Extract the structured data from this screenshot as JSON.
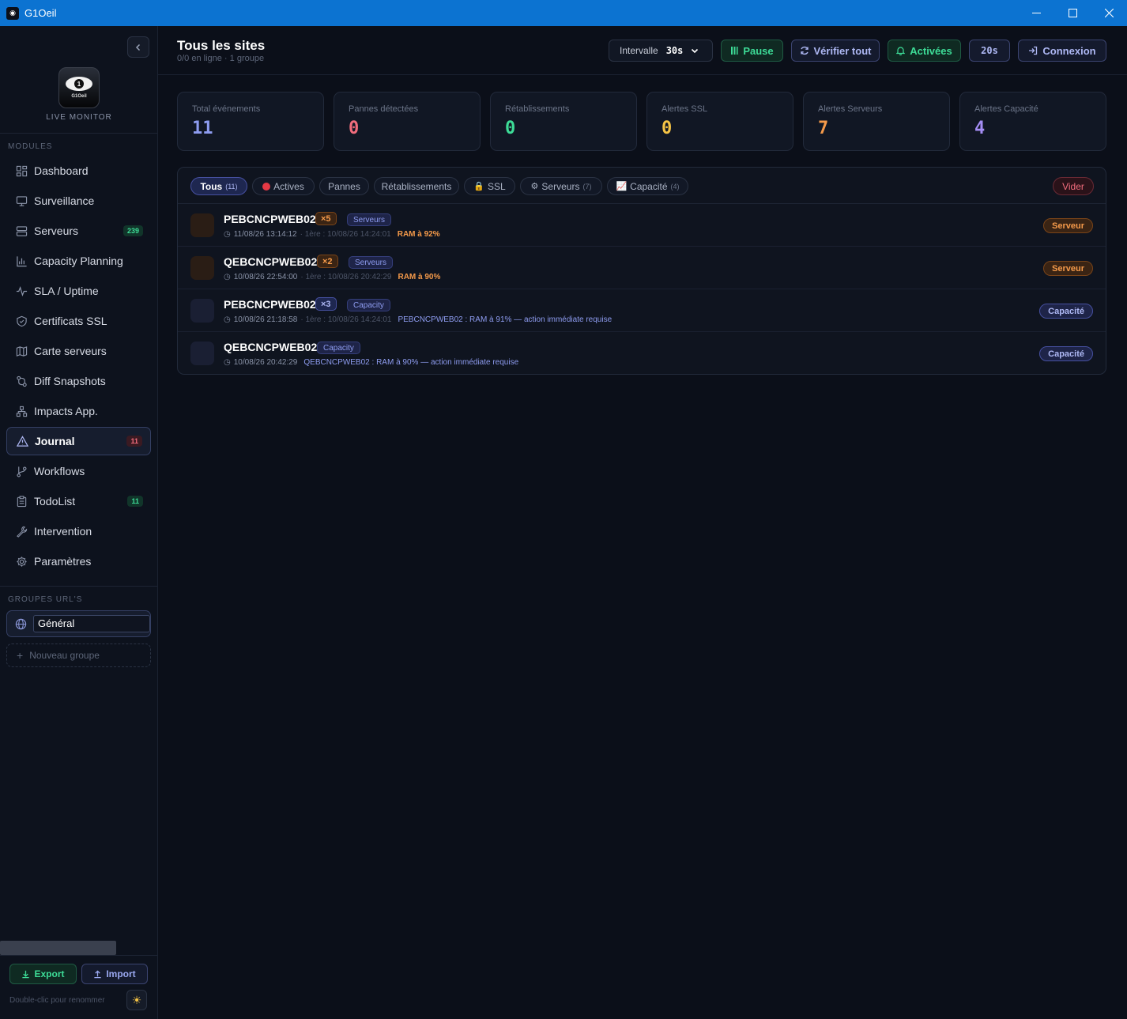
{
  "window": {
    "title": "G1Oeil",
    "minimize": "—",
    "maximize": "☐",
    "close": "✕"
  },
  "sidebar": {
    "logo_text": "G1Oeil",
    "logo_pupil": "1",
    "tagline": "LIVE MONITOR",
    "modules_label": "MODULES",
    "items": [
      {
        "label": "Dashboard",
        "icon": "dashboard-icon"
      },
      {
        "label": "Surveillance",
        "icon": "monitor-icon"
      },
      {
        "label": "Serveurs",
        "icon": "server-icon",
        "badge": "239"
      },
      {
        "label": "Capacity Planning",
        "icon": "bar-chart-icon"
      },
      {
        "label": "SLA / Uptime",
        "icon": "activity-icon"
      },
      {
        "label": "Certificats SSL",
        "icon": "shield-icon"
      },
      {
        "label": "Carte serveurs",
        "icon": "map-icon"
      },
      {
        "label": "Diff Snapshots",
        "icon": "diff-icon"
      },
      {
        "label": "Impacts App.",
        "icon": "network-icon"
      },
      {
        "label": "Journal",
        "icon": "alert-triangle-icon",
        "badge": "11",
        "active": true
      },
      {
        "label": "Workflows",
        "icon": "git-branch-icon"
      },
      {
        "label": "TodoList",
        "icon": "clipboard-icon",
        "badge": "11"
      },
      {
        "label": "Intervention",
        "icon": "wrench-icon"
      },
      {
        "label": "Paramètres",
        "icon": "gear-icon"
      }
    ],
    "groups_label": "GROUPES URL'S",
    "group_value": "Général",
    "new_group": "Nouveau groupe",
    "export_label": "Export",
    "import_label": "Import",
    "rename_hint": "Double-clic pour renommer"
  },
  "header": {
    "title": "Tous les sites",
    "subtitle": "0/0 en ligne · 1 groupe",
    "interval_label": "Intervalle",
    "interval_value": "30s",
    "pause_label": "Pause",
    "verify_label": "Vérifier tout",
    "alerts_label": "Activées",
    "timer": "20s",
    "connexion_label": "Connexion"
  },
  "stats": [
    {
      "label": "Total événements",
      "value": "11",
      "color": "#8e9cf0"
    },
    {
      "label": "Pannes détectées",
      "value": "0",
      "color": "#f26d7d"
    },
    {
      "label": "Rétablissements",
      "value": "0",
      "color": "#3ddc97"
    },
    {
      "label": "Alertes SSL",
      "value": "0",
      "color": "#f6c445"
    },
    {
      "label": "Alertes Serveurs",
      "value": "7",
      "color": "#f59a4a"
    },
    {
      "label": "Alertes Capacité",
      "value": "4",
      "color": "#a58ef5"
    }
  ],
  "filters": [
    {
      "label": "Tous",
      "count": "(11)"
    },
    {
      "label": "Actives"
    },
    {
      "label": "Pannes"
    },
    {
      "label": "Rétablissements"
    },
    {
      "label": "SSL",
      "emoji": "🔒"
    },
    {
      "label": "Serveurs",
      "count": "(7)",
      "emoji": "⚙"
    },
    {
      "label": "Capacité",
      "count": "(4)",
      "emoji": "📈"
    }
  ],
  "clear_label": "Vider",
  "events": [
    {
      "name": "PEBCNCPWEB02",
      "count": "×5",
      "category": "Serveurs",
      "time": "11/08/26 13:14:12",
      "first": "· 1ère : 10/08/26 14:24:01",
      "message": "RAM à 92%",
      "tag": "Serveur"
    },
    {
      "name": "QEBCNCPWEB02",
      "count": "×2",
      "category": "Serveurs",
      "time": "10/08/26 22:54:00",
      "first": "· 1ère : 10/08/26 20:42:29",
      "message": "RAM à 90%",
      "tag": "Serveur"
    },
    {
      "name": "PEBCNCPWEB02",
      "count": "×3",
      "category": "Capacity",
      "time": "10/08/26 21:18:58",
      "first": "· 1ère : 10/08/26 14:24:01",
      "message": "PEBCNCPWEB02 : RAM à 91% — action immédiate requise",
      "tag": "Capacité"
    },
    {
      "name": "QEBCNCPWEB02",
      "category": "Capacity",
      "time": "10/08/26 20:42:29",
      "message": "QEBCNCPWEB02 : RAM à 90% — action immédiate requise",
      "tag": "Capacité"
    }
  ]
}
